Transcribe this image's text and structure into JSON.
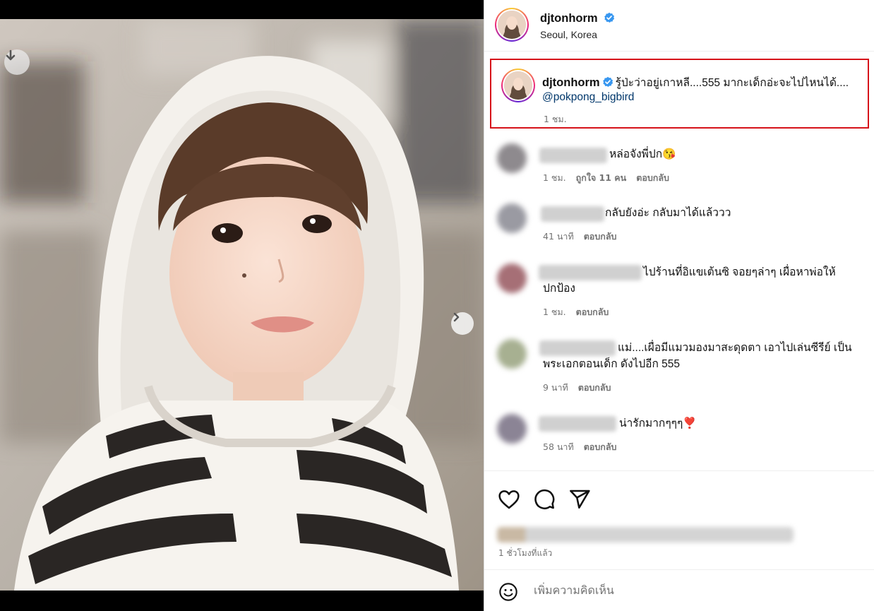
{
  "post": {
    "username": "djtonhorm",
    "location": "Seoul, Korea",
    "verified_icon": "verified-badge-icon",
    "accent": "#3897f0",
    "highlight_color": "#d6131a"
  },
  "caption": {
    "username": "djtonhorm",
    "text": "รู้ป่ะว่าอยู่เกาหลี....555 มากะเด็กอ่ะจะไปไหนได้....",
    "mention": "@pokpong_bigbird",
    "time": "1 ชม."
  },
  "comments": [
    {
      "text": "หล่อจังพี่ปก😘",
      "time": "1 ชม.",
      "likes": "ถูกใจ 11 คน",
      "reply": "ตอบกลับ"
    },
    {
      "text": "กลับยังอ่ะ กลับมาได้แล้ววว",
      "time": "41 นาที",
      "likes": "",
      "reply": "ตอบกลับ"
    },
    {
      "text_line1": "ไปร้านที่อิแขเต้นซิ จอยๆล่าๆ เผื่อหาพ่อให้",
      "text_line2": "ปกป้อง",
      "time": "1 ชม.",
      "likes": "",
      "reply": "ตอบกลับ"
    },
    {
      "text_line1": "แม่....เผื่อมีแมวมองมาสะดุดตา เอาไปเล่นซีรีย์ เป็น",
      "text_line2": "พระเอกตอนเด็ก ดังไปอีก 555",
      "time": "9 นาที",
      "likes": "",
      "reply": "ตอบกลับ"
    },
    {
      "text": "น่ารักมากๆๆๆ❣️",
      "time": "58 นาที",
      "likes": "",
      "reply": "ตอบกลับ"
    }
  ],
  "actions": {
    "like_icon": "heart-icon",
    "comment_icon": "comment-icon",
    "share_icon": "send-icon",
    "post_time": "1 ชั่วโมงที่แล้ว"
  },
  "add_comment": {
    "emoji_icon": "smiley-icon",
    "placeholder": "เพิ่มความคิดเห็น"
  },
  "photo": {
    "download_icon": "arrow-down-icon",
    "next_icon": "chevron-right-icon"
  }
}
